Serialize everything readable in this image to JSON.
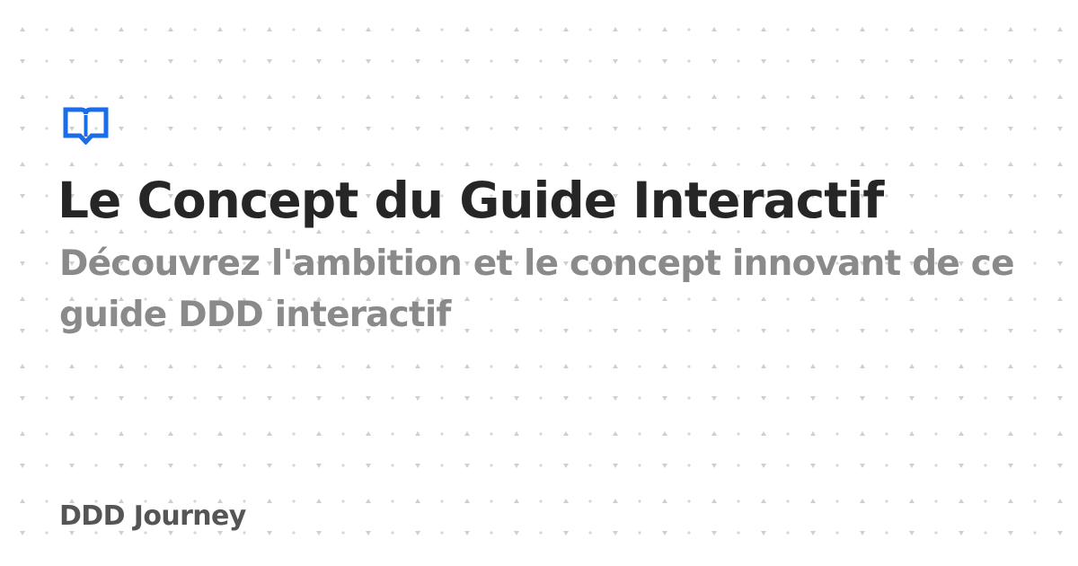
{
  "card": {
    "logo_icon": "open-book-icon",
    "accent_color": "#1a6ce8",
    "title": "Le Concept du Guide Interactif",
    "subtitle": "Découvrez l'ambition et le concept innovant de ce guide DDD interactif",
    "brand": "DDD Journey"
  }
}
